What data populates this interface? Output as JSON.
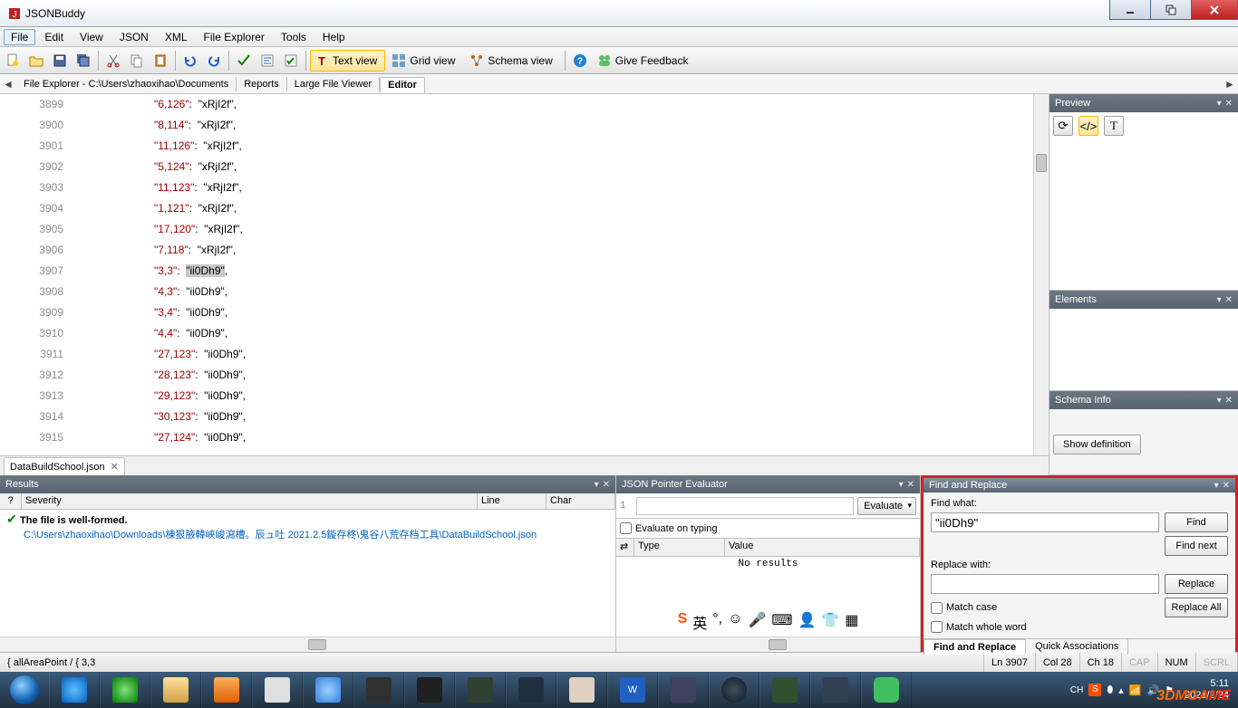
{
  "window": {
    "title": "JSONBuddy"
  },
  "menu": {
    "file": "File",
    "edit": "Edit",
    "view": "View",
    "json": "JSON",
    "xml": "XML",
    "explorer": "File Explorer",
    "tools": "Tools",
    "help": "Help"
  },
  "viewmodes": {
    "text": "Text view",
    "grid": "Grid view",
    "schema": "Schema view",
    "feedback": "Give Feedback"
  },
  "crumbs": {
    "path": "File Explorer - C:\\Users\\zhaoxihao\\Documents",
    "reports": "Reports",
    "lfv": "Large File Viewer",
    "editor": "Editor"
  },
  "lines": [
    {
      "n": "3899",
      "k": "\"6,126\"",
      "v": "\"xRjI2f\","
    },
    {
      "n": "3900",
      "k": "\"8,114\"",
      "v": "\"xRjI2f\","
    },
    {
      "n": "3901",
      "k": "\"11,126\"",
      "v": "\"xRjI2f\","
    },
    {
      "n": "3902",
      "k": "\"5,124\"",
      "v": "\"xRjI2f\","
    },
    {
      "n": "3903",
      "k": "\"11,123\"",
      "v": "\"xRjI2f\","
    },
    {
      "n": "3904",
      "k": "\"1,121\"",
      "v": "\"xRjI2f\","
    },
    {
      "n": "3905",
      "k": "\"17,120\"",
      "v": "\"xRjI2f\","
    },
    {
      "n": "3906",
      "k": "\"7,118\"",
      "v": "\"xRjI2f\","
    },
    {
      "n": "3907",
      "k": "\"3,3\"",
      "v": "\"ii0Dh9\"",
      "hl": true,
      "tail": ","
    },
    {
      "n": "3908",
      "k": "\"4,3\"",
      "v": "\"ii0Dh9\","
    },
    {
      "n": "3909",
      "k": "\"3,4\"",
      "v": "\"ii0Dh9\","
    },
    {
      "n": "3910",
      "k": "\"4,4\"",
      "v": "\"ii0Dh9\","
    },
    {
      "n": "3911",
      "k": "\"27,123\"",
      "v": "\"ii0Dh9\","
    },
    {
      "n": "3912",
      "k": "\"28,123\"",
      "v": "\"ii0Dh9\","
    },
    {
      "n": "3913",
      "k": "\"29,123\"",
      "v": "\"ii0Dh9\","
    },
    {
      "n": "3914",
      "k": "\"30,123\"",
      "v": "\"ii0Dh9\","
    },
    {
      "n": "3915",
      "k": "\"27,124\"",
      "v": "\"ii0Dh9\","
    }
  ],
  "filetab": {
    "name": "DataBuildSchool.json"
  },
  "panels": {
    "preview": "Preview",
    "elements": "Elements",
    "schemainfo": "Schema Info",
    "showdef": "Show definition"
  },
  "results": {
    "title": "Results",
    "cols": {
      "sev": "Severity",
      "line": "Line",
      "char": "Char"
    },
    "q": "?",
    "msg": "The file is well-formed.",
    "path": "C:\\Users\\zhaoxihao\\Downloads\\棟狠腋韓峽峻瀉槽。辰ュ吐 2021.2.5鏇存柊\\鬼谷八荒存档工具\\DataBuildSchool.json"
  },
  "evaluator": {
    "title": "JSON Pointer Evaluator",
    "linenum": "1",
    "btn": "Evaluate",
    "chk": "Evaluate on typing",
    "cols": {
      "type": "Type",
      "value": "Value"
    },
    "nores": "No results"
  },
  "find": {
    "title": "Find and Replace",
    "findwhat": "Find what:",
    "value": "\"ii0Dh9\"",
    "find": "Find",
    "findnext": "Find next",
    "repwith": "Replace with:",
    "repvalue": "",
    "replace": "Replace",
    "replaceall": "Replace All",
    "matchcase": "Match case",
    "matchword": "Match whole word",
    "tab1": "Find and Replace",
    "tab2": "Quick Associations"
  },
  "status": {
    "pointer": "{ allAreaPoint / { 3,3",
    "ln": "Ln 3907",
    "col": "Col 28",
    "ch": "Ch 18",
    "cap": "CAP",
    "num": "NUM",
    "scrl": "SCRL"
  },
  "clock": {
    "time": "5:11",
    "date": "2021/2/24"
  },
  "watermark": "3DMGAME",
  "ime": "英"
}
